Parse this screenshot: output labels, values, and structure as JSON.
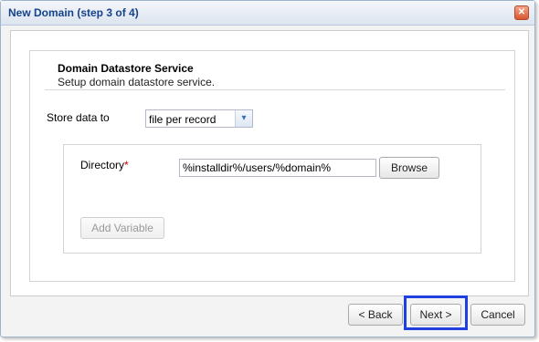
{
  "window": {
    "title": "New Domain (step 3 of 4)",
    "close_glyph": "✕"
  },
  "section": {
    "title": "Domain Datastore Service",
    "subtitle": "Setup domain datastore service."
  },
  "store": {
    "label": "Store data to",
    "selected": "file per record",
    "arrow_glyph": "▾"
  },
  "directory": {
    "label": "Directory",
    "required_mark": "*",
    "value": "%installdir%/users/%domain%",
    "browse_label": "Browse"
  },
  "add_variable_label": "Add Variable",
  "footer": {
    "back_label": "< Back",
    "next_label": "Next >",
    "cancel_label": "Cancel"
  },
  "colors": {
    "highlight": "#1f3fe0",
    "title_text": "#15428b",
    "required": "#cc0000"
  }
}
